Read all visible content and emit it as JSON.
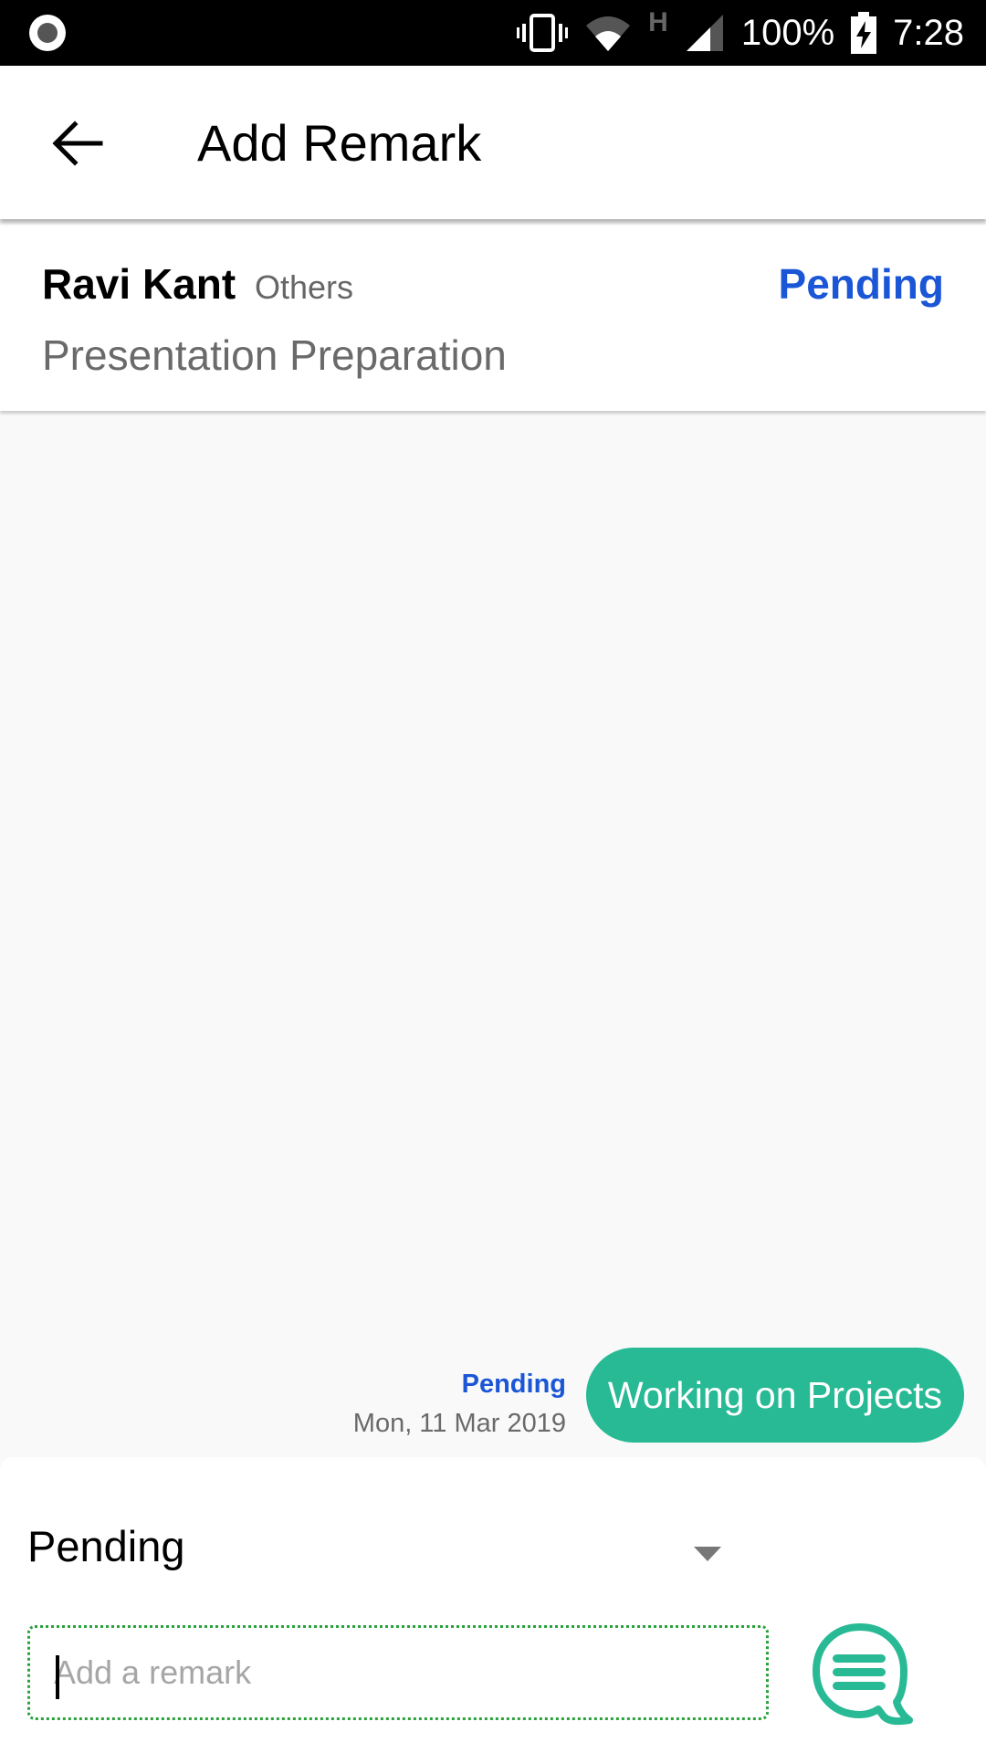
{
  "status_bar": {
    "icons": [
      "screen-record-icon",
      "vibrate-icon",
      "wifi-icon",
      "h-network-icon",
      "signal-icon",
      "battery-charging-icon"
    ],
    "network_type": "H",
    "battery": "100%",
    "time": "7:28"
  },
  "app_bar": {
    "back_icon": "arrow-left-icon",
    "title": "Add Remark"
  },
  "task_header": {
    "name": "Ravi Kant",
    "category": "Others",
    "status": "Pending",
    "task": "Presentation Preparation"
  },
  "remarks": [
    {
      "status": "Pending",
      "date": "Mon, 11 Mar 2019",
      "text": "Working on Projects"
    }
  ],
  "composer": {
    "status_select": {
      "selected": "Pending"
    },
    "remark_input": {
      "value": "",
      "placeholder": "Add a remark"
    },
    "send_icon": "chat-bubble-icon"
  },
  "colors": {
    "accent_green": "#28b995",
    "status_blue": "#1a56d6",
    "input_border": "#2aa23c"
  }
}
